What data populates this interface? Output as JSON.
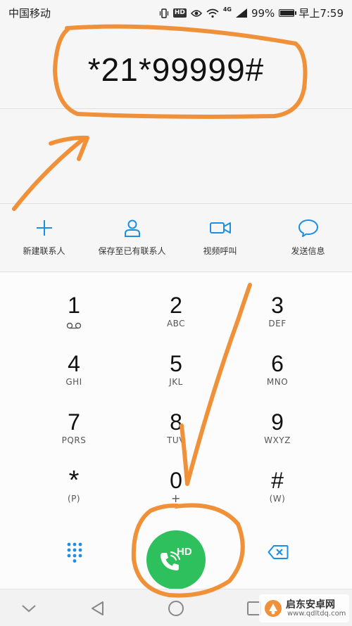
{
  "status_bar": {
    "carrier": "中国移动",
    "hd": "HD",
    "network": "4G",
    "battery": "99%",
    "battery_level": 0.99,
    "time": "早上7:59"
  },
  "dial": {
    "number": "*21*99999#"
  },
  "actions": [
    {
      "label": "新建联系人",
      "icon": "plus-icon"
    },
    {
      "label": "保存至已有联系人",
      "icon": "person-icon"
    },
    {
      "label": "视频呼叫",
      "icon": "video-camera-icon"
    },
    {
      "label": "发送信息",
      "icon": "chat-bubble-icon"
    }
  ],
  "keypad": [
    {
      "digit": "1",
      "letters": "",
      "sub_icon": "voicemail-icon"
    },
    {
      "digit": "2",
      "letters": "ABC"
    },
    {
      "digit": "3",
      "letters": "DEF"
    },
    {
      "digit": "4",
      "letters": "GHI"
    },
    {
      "digit": "5",
      "letters": "JKL"
    },
    {
      "digit": "6",
      "letters": "MNO"
    },
    {
      "digit": "7",
      "letters": "PQRS"
    },
    {
      "digit": "8",
      "letters": "TUV"
    },
    {
      "digit": "9",
      "letters": "WXYZ"
    },
    {
      "digit": "*",
      "letters": "(P)"
    },
    {
      "digit": "0",
      "letters": "+"
    },
    {
      "digit": "#",
      "letters": "(W)"
    }
  ],
  "call_button": {
    "label": "HD",
    "icon": "phone-icon"
  },
  "colors": {
    "accent": "#1a8fe3",
    "call_green": "#2ec05c",
    "annotation_orange": "#f0913a"
  },
  "watermark": {
    "name": "启东安卓网",
    "url": "www.qdltdq.com"
  }
}
